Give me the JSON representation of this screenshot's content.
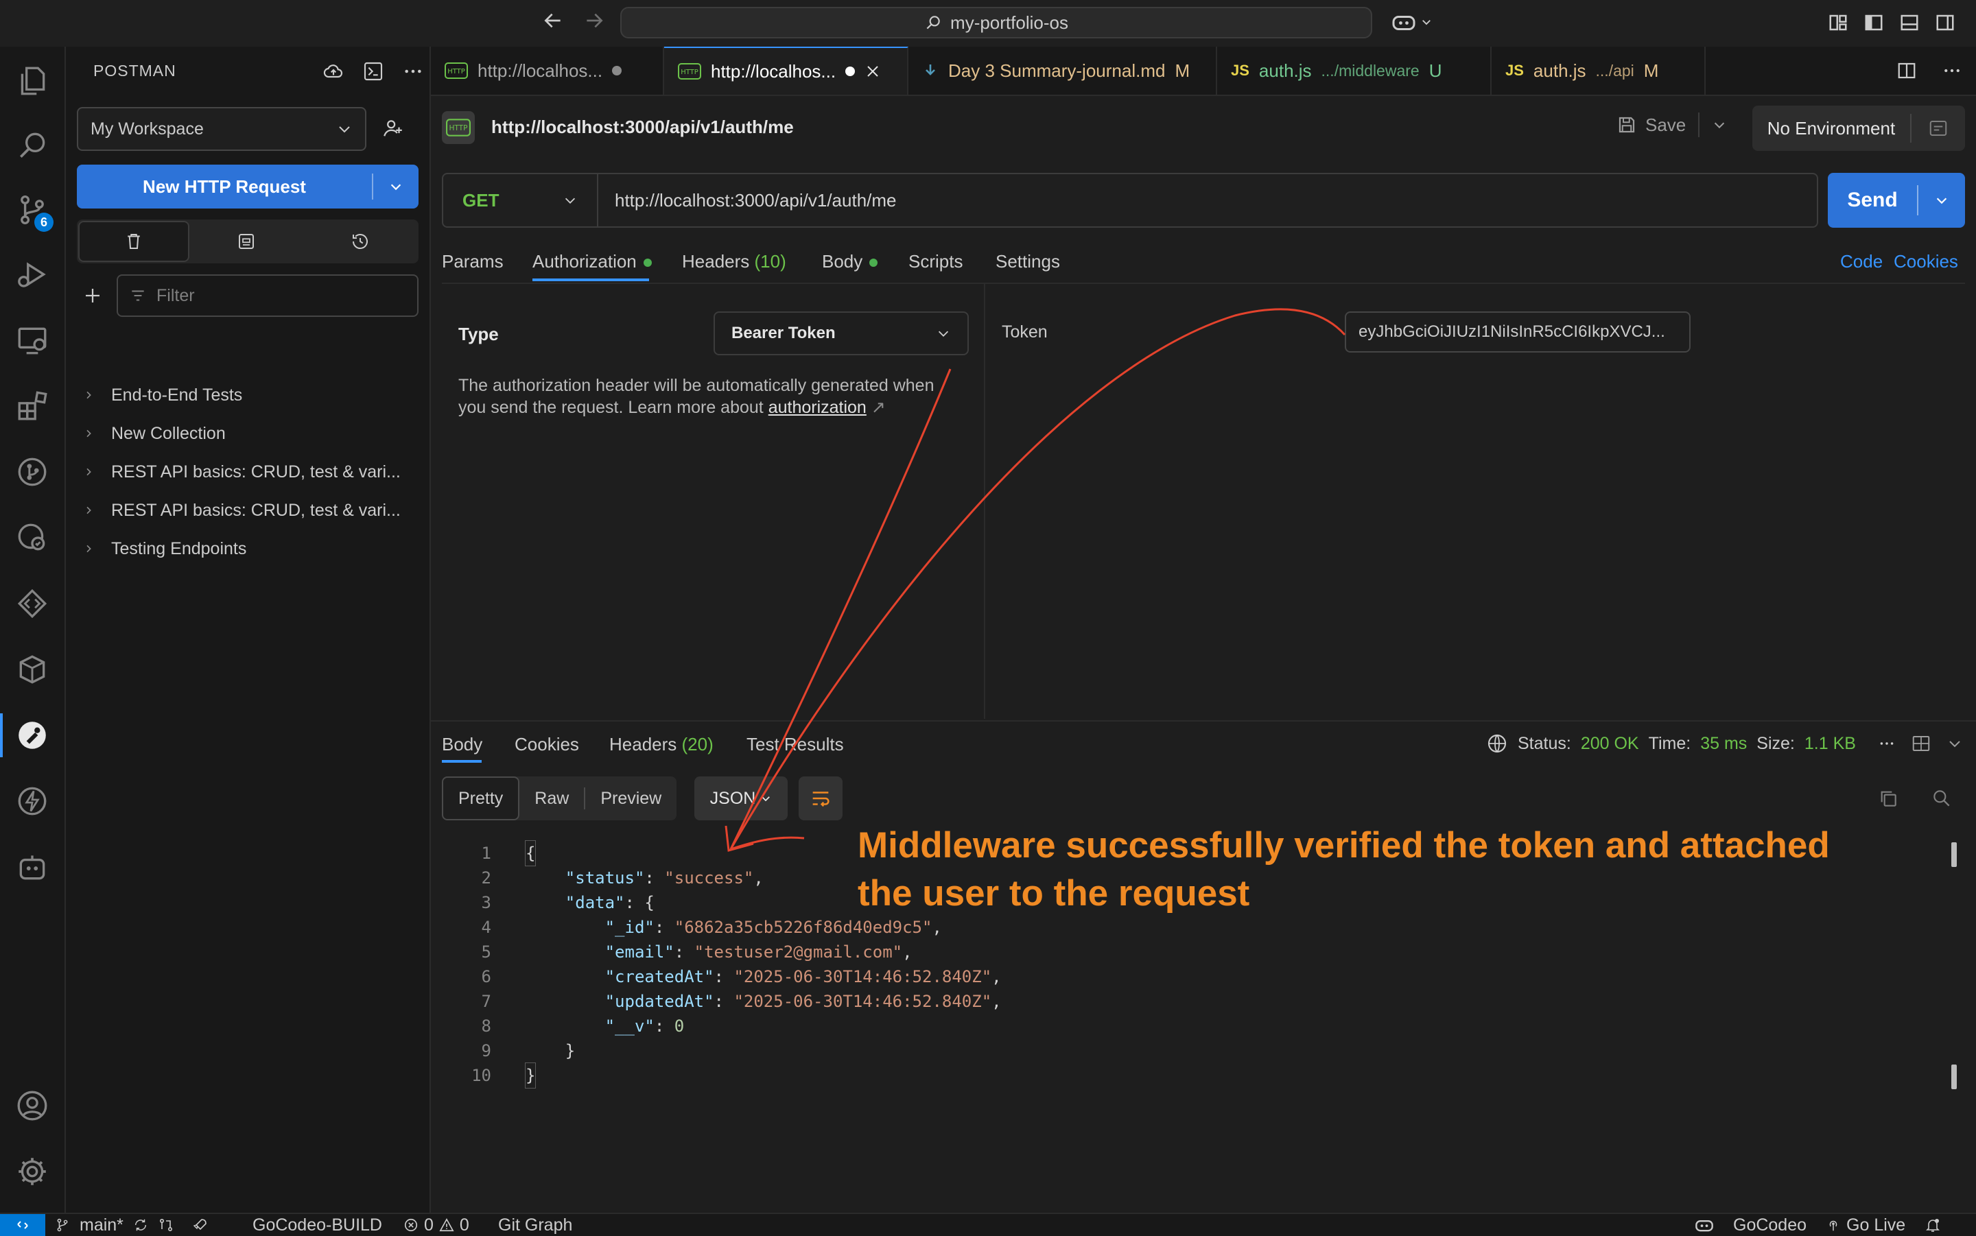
{
  "titlebar": {
    "command_center": "my-portfolio-os"
  },
  "activity": {
    "scm_badge": "6"
  },
  "sidebar": {
    "title": "POSTMAN",
    "workspace": "My Workspace",
    "new_request": "New HTTP Request",
    "filter_placeholder": "Filter",
    "tree": [
      "End-to-End Tests",
      "New Collection",
      "REST API basics: CRUD, test & vari...",
      "REST API basics: CRUD, test & vari...",
      "Testing Endpoints"
    ]
  },
  "tabs": [
    {
      "label": "http://localhos...",
      "extra": ""
    },
    {
      "label": "http://localhos...",
      "extra": ""
    },
    {
      "label": "Day 3 Summary-journal.md",
      "extra": "M"
    },
    {
      "label": "auth.js",
      "path": ".../middleware",
      "extra": "U"
    },
    {
      "label": "auth.js",
      "path": ".../api",
      "extra": "M"
    }
  ],
  "request": {
    "title": "http://localhost:3000/api/v1/auth/me",
    "save": "Save",
    "environment": "No Environment",
    "method": "GET",
    "url": "http://localhost:3000/api/v1/auth/me",
    "send": "Send",
    "subtabs": {
      "params": "Params",
      "authorization": "Authorization",
      "headers": "Headers",
      "headers_count": "(10)",
      "body": "Body",
      "scripts": "Scripts",
      "settings": "Settings",
      "code": "Code",
      "cookies": "Cookies"
    }
  },
  "auth": {
    "type_label": "Type",
    "type_value": "Bearer Token",
    "desc": "The authorization header will be automatically generated when you send the request. Learn more about ",
    "link": "authorization",
    "token_label": "Token",
    "token_value": "eyJhbGciOiJIUzI1NiIsInR5cCI6IkpXVCJ..."
  },
  "response": {
    "tabs": {
      "body": "Body",
      "cookies": "Cookies",
      "headers": "Headers",
      "headers_count": "(20)",
      "tests": "Test Results"
    },
    "status_label": "Status:",
    "status_value": "200 OK",
    "time_label": "Time:",
    "time_value": "35 ms",
    "size_label": "Size:",
    "size_value": "1.1 KB",
    "formats": [
      "Pretty",
      "Raw",
      "Preview"
    ],
    "language": "JSON",
    "json": {
      "status": "success",
      "_id": "6862a35cb5226f86d40ed9c5",
      "email": "testuser2@gmail.com",
      "createdAt": "2025-06-30T14:46:52.840Z",
      "updatedAt": "2025-06-30T14:46:52.840Z",
      "v": "0"
    }
  },
  "annotation": {
    "line1": "Middleware successfully verified the token and attached",
    "line2": "the user to the request"
  },
  "statusbar": {
    "branch": "main*",
    "build": "GoCodeo-BUILD",
    "errors": "0",
    "warnings": "0",
    "git_graph": "Git Graph",
    "gocodeo": "GoCodeo",
    "go_live": "Go Live"
  }
}
